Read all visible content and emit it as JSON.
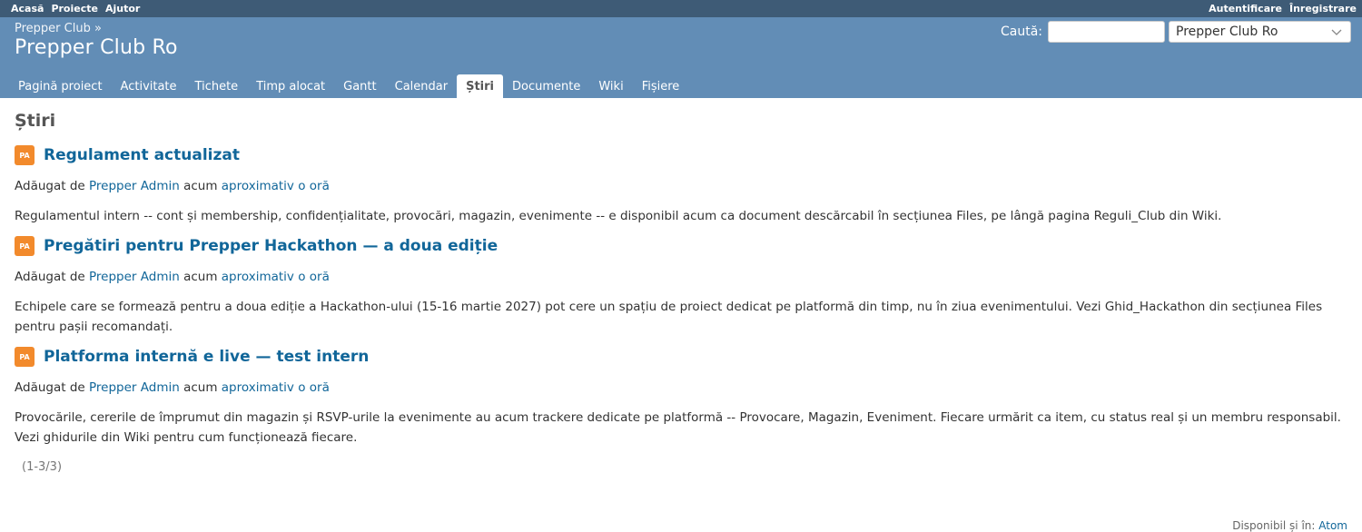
{
  "top_menu": {
    "left": [
      "Acasă",
      "Proiecte",
      "Ajutor"
    ],
    "right": [
      "Autentificare",
      "Înregistrare"
    ]
  },
  "header": {
    "breadcrumb": "Prepper Club »",
    "title": "Prepper Club Ro"
  },
  "search": {
    "label": "Caută:",
    "value": "",
    "jump_selected": "Prepper Club Ro"
  },
  "tabs": [
    {
      "label": "Pagină proiect",
      "selected": false
    },
    {
      "label": "Activitate",
      "selected": false
    },
    {
      "label": "Tichete",
      "selected": false
    },
    {
      "label": "Timp alocat",
      "selected": false
    },
    {
      "label": "Gantt",
      "selected": false
    },
    {
      "label": "Calendar",
      "selected": false
    },
    {
      "label": "Știri",
      "selected": true
    },
    {
      "label": "Documente",
      "selected": false
    },
    {
      "label": "Wiki",
      "selected": false
    },
    {
      "label": "Fișiere",
      "selected": false
    }
  ],
  "page": {
    "title": "Știri",
    "avatar_color": "#f28a2c",
    "news": [
      {
        "avatar": "PA",
        "title": "Regulament actualizat",
        "added_prefix": "Adăugat de",
        "author": "Prepper Admin",
        "ago_prefix": "acum",
        "time": "aproximativ o oră",
        "summary": "Regulamentul intern -- cont și membership, confidențialitate, provocări, magazin, evenimente -- e disponibil acum ca document descărcabil în secțiunea Files, pe lângă pagina Reguli_Club din Wiki."
      },
      {
        "avatar": "PA",
        "title": "Pregătiri pentru Prepper Hackathon — a doua ediție",
        "added_prefix": "Adăugat de",
        "author": "Prepper Admin",
        "ago_prefix": "acum",
        "time": "aproximativ o oră",
        "summary": "Echipele care se formează pentru a doua ediție a Hackathon-ului (15-16 martie 2027) pot cere un spațiu de proiect dedicat pe platformă din timp, nu în ziua evenimentului. Vezi Ghid_Hackathon din secțiunea Files pentru pașii recomandați."
      },
      {
        "avatar": "PA",
        "title": "Platforma internă e live — test intern",
        "added_prefix": "Adăugat de",
        "author": "Prepper Admin",
        "ago_prefix": "acum",
        "time": "aproximativ o oră",
        "summary": "Provocările, cererile de împrumut din magazin și RSVP-urile la evenimente au acum trackere dedicate pe platformă -- Provocare, Magazin, Eveniment. Fiecare urmărit ca item, cu status real și un membru responsabil. Vezi ghidurile din Wiki pentru cum funcționează fiecare."
      }
    ],
    "pagination": "(1-3/3)",
    "other_formats_label": "Disponibil și în:",
    "other_formats_link": "Atom"
  }
}
